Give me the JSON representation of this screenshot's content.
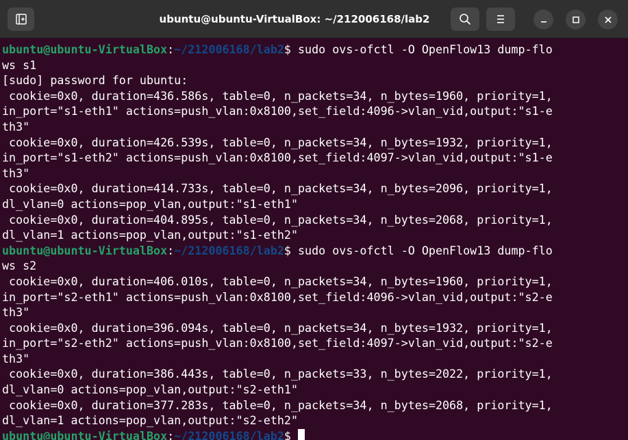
{
  "window": {
    "title": "ubuntu@ubuntu-VirtualBox: ~/212006168/lab2",
    "buttons": {
      "new_tab": "new-tab-icon",
      "search": "search-icon",
      "menu": "hamburger-icon",
      "minimize": "minimize-icon",
      "maximize": "maximize-icon",
      "close": "close-icon"
    }
  },
  "colors": {
    "background": "#300a24",
    "prompt_user": "#26a269",
    "prompt_path": "#12488b",
    "text": "#ffffff"
  },
  "prompt": {
    "user": "ubuntu@ubuntu-VirtualBox",
    "colon": ":",
    "path": "~/212006168/lab2",
    "dollar": "$"
  },
  "terminal": {
    "lines": [
      {
        "type": "prompt",
        "cmd": " sudo ovs-ofctl -O OpenFlow13 dump-flo"
      },
      {
        "type": "text",
        "text": "ws s1"
      },
      {
        "type": "text",
        "text": "[sudo] password for ubuntu:"
      },
      {
        "type": "text",
        "text": " cookie=0x0, duration=436.586s, table=0, n_packets=34, n_bytes=1960, priority=1,"
      },
      {
        "type": "text",
        "text": "in_port=\"s1-eth1\" actions=push_vlan:0x8100,set_field:4096->vlan_vid,output:\"s1-e"
      },
      {
        "type": "text",
        "text": "th3\""
      },
      {
        "type": "text",
        "text": " cookie=0x0, duration=426.539s, table=0, n_packets=34, n_bytes=1932, priority=1,"
      },
      {
        "type": "text",
        "text": "in_port=\"s1-eth2\" actions=push_vlan:0x8100,set_field:4097->vlan_vid,output:\"s1-e"
      },
      {
        "type": "text",
        "text": "th3\""
      },
      {
        "type": "text",
        "text": " cookie=0x0, duration=414.733s, table=0, n_packets=34, n_bytes=2096, priority=1,"
      },
      {
        "type": "text",
        "text": "dl_vlan=0 actions=pop_vlan,output:\"s1-eth1\""
      },
      {
        "type": "text",
        "text": " cookie=0x0, duration=404.895s, table=0, n_packets=34, n_bytes=2068, priority=1,"
      },
      {
        "type": "text",
        "text": "dl_vlan=1 actions=pop_vlan,output:\"s1-eth2\""
      },
      {
        "type": "prompt",
        "cmd": " sudo ovs-ofctl -O OpenFlow13 dump-flo"
      },
      {
        "type": "text",
        "text": "ws s2"
      },
      {
        "type": "text",
        "text": " cookie=0x0, duration=406.010s, table=0, n_packets=34, n_bytes=1960, priority=1,"
      },
      {
        "type": "text",
        "text": "in_port=\"s2-eth1\" actions=push_vlan:0x8100,set_field:4096->vlan_vid,output:\"s2-e"
      },
      {
        "type": "text",
        "text": "th3\""
      },
      {
        "type": "text",
        "text": " cookie=0x0, duration=396.094s, table=0, n_packets=34, n_bytes=1932, priority=1,"
      },
      {
        "type": "text",
        "text": "in_port=\"s2-eth2\" actions=push_vlan:0x8100,set_field:4097->vlan_vid,output:\"s2-e"
      },
      {
        "type": "text",
        "text": "th3\""
      },
      {
        "type": "text",
        "text": " cookie=0x0, duration=386.443s, table=0, n_packets=33, n_bytes=2022, priority=1,"
      },
      {
        "type": "text",
        "text": "dl_vlan=0 actions=pop_vlan,output:\"s2-eth1\""
      },
      {
        "type": "text",
        "text": " cookie=0x0, duration=377.283s, table=0, n_packets=34, n_bytes=2068, priority=1,"
      },
      {
        "type": "text",
        "text": "dl_vlan=1 actions=pop_vlan,output:\"s2-eth2\""
      },
      {
        "type": "prompt",
        "cmd": " ",
        "cursor": true
      }
    ]
  }
}
